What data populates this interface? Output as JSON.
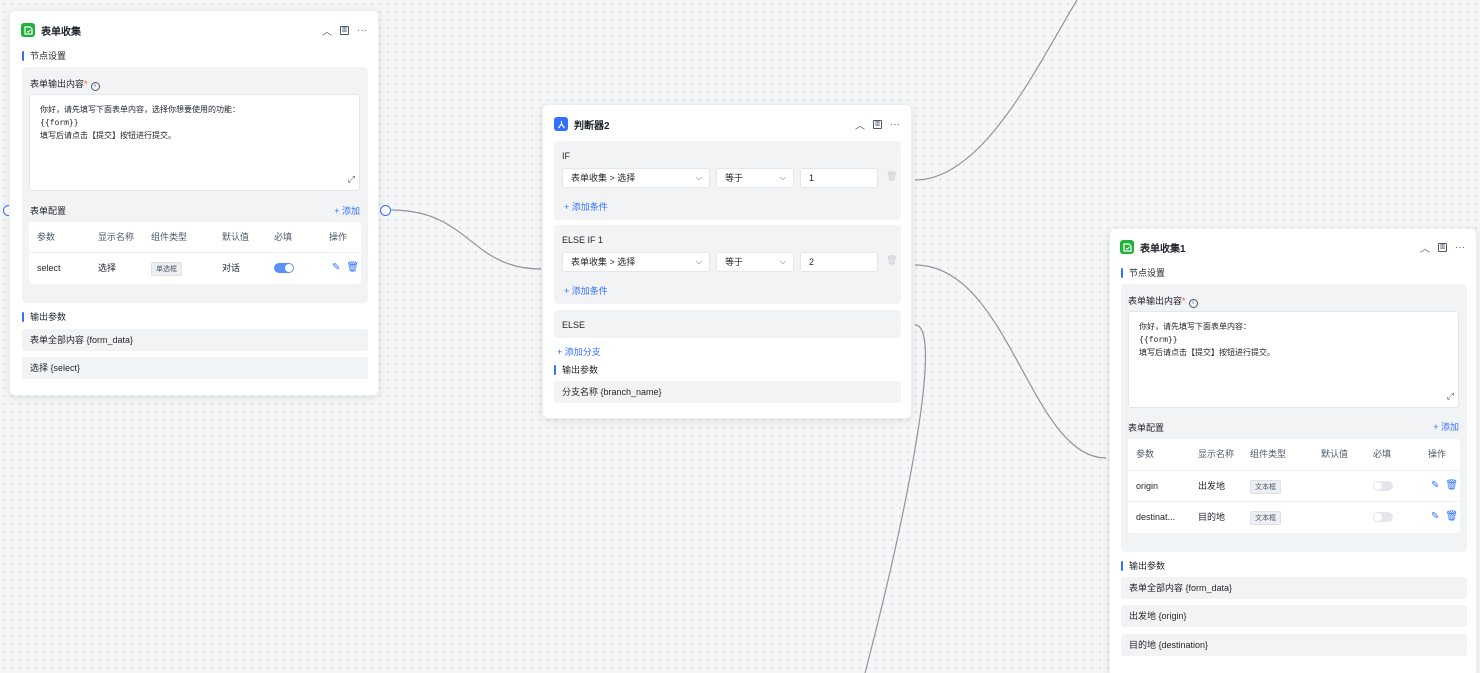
{
  "colors": {
    "accent": "#3370ff",
    "form_icon": "#1fb13a",
    "edge": "#8f959e"
  },
  "node_form": {
    "title": "表单收集",
    "icon": "form-icon",
    "section_settings": "节点设置",
    "output_content_label": "表单输出内容",
    "required_mark": "*",
    "textarea_lines": [
      "你好，请先填写下面表单内容，选择你想要使用的功能：",
      "{{form}}",
      "填写后请点击【提交】按钮进行提交。"
    ],
    "config_label": "表单配置",
    "add_label": "+ 添加",
    "headers": [
      "参数",
      "显示名称",
      "组件类型",
      "默认值",
      "必填",
      "操作"
    ],
    "rows": [
      {
        "param": "select",
        "display": "选择",
        "type": "单选框",
        "default": "对话",
        "required": true
      }
    ],
    "section_output": "输出参数",
    "outputs": [
      "表单全部内容 {form_data}",
      "选择 {select}"
    ]
  },
  "node_judge": {
    "title": "判断器2",
    "icon": "branch-icon",
    "conditions": [
      {
        "label": "IF",
        "field": "表单收集 > 选择",
        "op": "等于",
        "value": "1",
        "add": "+ 添加条件"
      },
      {
        "label": "ELSE IF 1",
        "field": "表单收集 > 选择",
        "op": "等于",
        "value": "2",
        "add": "+ 添加条件"
      }
    ],
    "else_label": "ELSE",
    "add_branch": "+ 添加分支",
    "section_output": "输出参数",
    "outputs": [
      "分支名称 {branch_name}"
    ]
  },
  "node_form1": {
    "title": "表单收集1",
    "icon": "form-icon",
    "section_settings": "节点设置",
    "output_content_label": "表单输出内容",
    "required_mark": "*",
    "textarea_lines": [
      "你好，请先填写下面表单内容：",
      "{{form}}",
      "填写后请点击【提交】按钮进行提交。"
    ],
    "config_label": "表单配置",
    "add_label": "+ 添加",
    "headers": [
      "参数",
      "显示名称",
      "组件类型",
      "默认值",
      "必填",
      "操作"
    ],
    "rows": [
      {
        "param": "origin",
        "display": "出发地",
        "type": "文本框",
        "default": "",
        "required": false
      },
      {
        "param": "destinat...",
        "display": "目的地",
        "type": "文本框",
        "default": "",
        "required": false
      }
    ],
    "section_output": "输出参数",
    "outputs": [
      "表单全部内容 {form_data}",
      "出发地 {origin}",
      "目的地 {destination}"
    ]
  }
}
